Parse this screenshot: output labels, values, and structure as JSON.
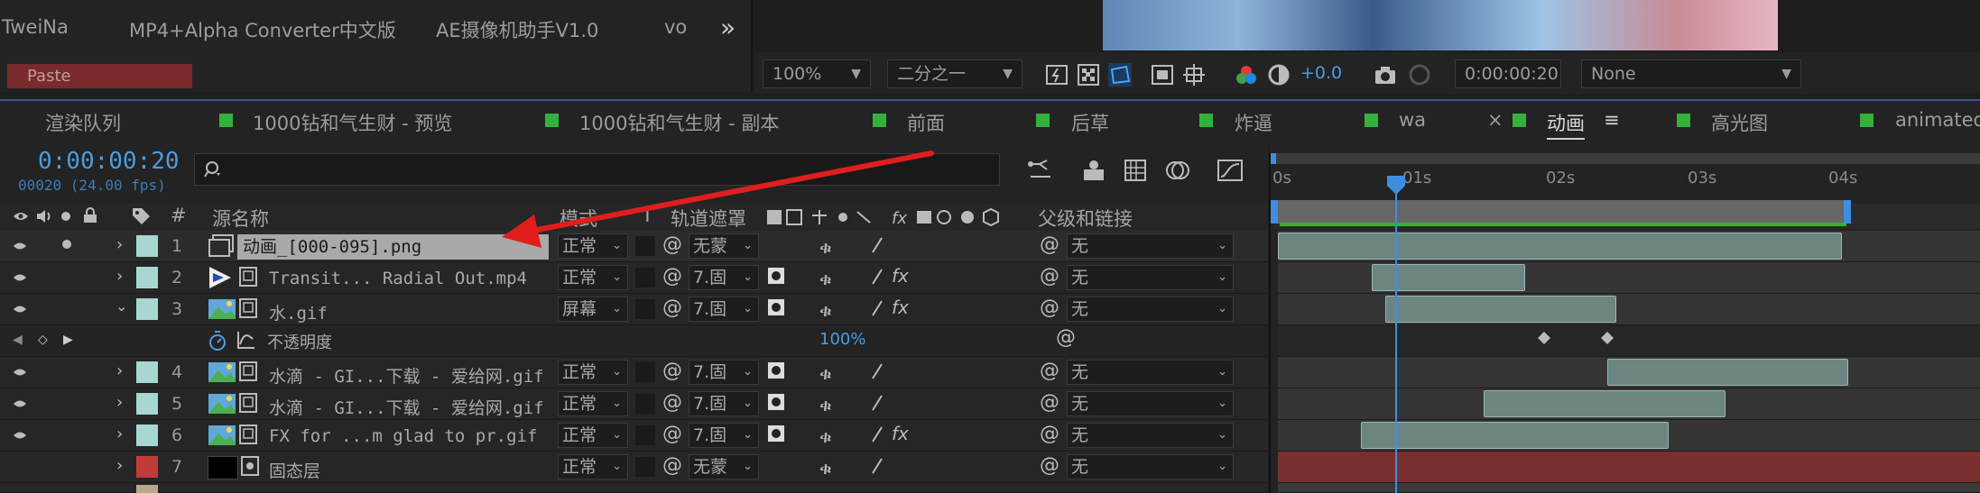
{
  "top_tabs": [
    "TweiNa",
    "MP4+Alpha Converter中文版",
    "AE摄像机助手V1.0",
    "vo"
  ],
  "overflow_label": "»",
  "paste_label": "Paste",
  "viewer": {
    "zoom": "100%",
    "resolution": "二分之一",
    "exposure": "+0.0",
    "timecode": "0:00:00:20",
    "view": "None"
  },
  "comp_tabs": [
    {
      "label": "渲染队列",
      "active": false
    },
    {
      "label": "1000钻和气生财 - 预览",
      "active": false
    },
    {
      "label": "1000钻和气生财 - 副本",
      "active": false
    },
    {
      "label": "前面",
      "active": false
    },
    {
      "label": "后草",
      "active": false
    },
    {
      "label": "炸逼",
      "active": false
    },
    {
      "label": "wa",
      "active": false
    },
    {
      "label": "动画",
      "active": true
    },
    {
      "label": "高光图",
      "active": false
    },
    {
      "label": "animated_b",
      "active": false
    }
  ],
  "tab_close": "×",
  "tab_menu": "≡",
  "timeline": {
    "current_time": "0:00:00:20",
    "frames_fps": "00020 (24.00 fps)",
    "search_placeholder": "",
    "columns": {
      "number": "#",
      "source_name": "源名称",
      "mode": "模式",
      "t": "T",
      "track_matte": "轨道遮罩",
      "parent": "父级和链接"
    },
    "ruler_ticks": [
      "0s",
      "01s",
      "02s",
      "03s",
      "04s"
    ],
    "layers": [
      {
        "num": "1",
        "name": "动画_[000-095].png",
        "mode": "正常",
        "matte": "无蒙",
        "parent": "无",
        "swatch": "#a8d6d0",
        "selected": true
      },
      {
        "num": "2",
        "name": "Transit... Radial Out.mp4",
        "mode": "正常",
        "matte": "7.固",
        "parent": "无",
        "swatch": "#a8d6d0",
        "selected": false
      },
      {
        "num": "3",
        "name": "水.gif",
        "mode": "屏幕",
        "matte": "7.固",
        "parent": "无",
        "swatch": "#a8d6d0",
        "selected": false
      },
      {
        "num": "4",
        "name": "水滴 - GI...下载 - 爱给网.gif",
        "mode": "正常",
        "matte": "7.固",
        "parent": "无",
        "swatch": "#a8d6d0",
        "selected": false
      },
      {
        "num": "5",
        "name": "水滴 - GI...下载 - 爱给网.gif",
        "mode": "正常",
        "matte": "7.固",
        "parent": "无",
        "swatch": "#a8d6d0",
        "selected": false
      },
      {
        "num": "6",
        "name": "FX for ...m glad to pr.gif",
        "mode": "正常",
        "matte": "7.固",
        "parent": "无",
        "swatch": "#a8d6d0",
        "selected": false
      },
      {
        "num": "7",
        "name": "固态层",
        "mode": "正常",
        "matte": "无蒙",
        "parent": "无",
        "swatch": "#c23b3b",
        "selected": false
      }
    ],
    "property": {
      "name": "不透明度",
      "value": "100%"
    }
  }
}
